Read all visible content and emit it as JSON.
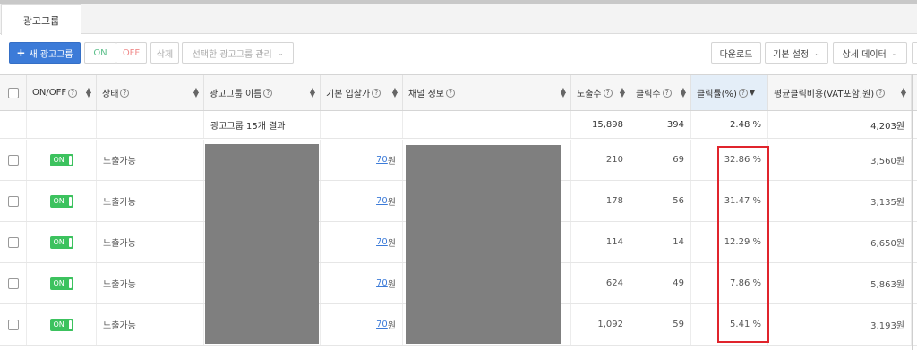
{
  "tab": {
    "label": "광고그룹"
  },
  "toolbar": {
    "new_label": "새 광고그룹",
    "new_icon": "plus-icon",
    "on_label": "ON",
    "off_label": "OFF",
    "delete_label": "삭제",
    "manage_label": "선택한 광고그룹 관리",
    "download_label": "다운로드",
    "basic_settings_label": "기본 설정",
    "detail_data_label": "상세 데이터"
  },
  "columns": {
    "onoff": "ON/OFF",
    "status": "상태",
    "name": "광고그룹 이름",
    "bid": "기본 입찰가",
    "channel": "채널 정보",
    "impressions": "노출수",
    "clicks": "클릭수",
    "ctr": "클릭률(%)",
    "cpc": "평균클릭비용(VAT포함,원)"
  },
  "summary": {
    "label": "광고그룹 15개 결과",
    "impressions": "15,898",
    "clicks": "394",
    "ctr": "2.48 %",
    "cpc": "4,203원"
  },
  "rows": [
    {
      "toggle": "ON",
      "status": "노출가능",
      "bid": "70",
      "bid_unit": "원",
      "impressions": "210",
      "clicks": "69",
      "ctr": "32.86 %",
      "cpc": "3,560원"
    },
    {
      "toggle": "ON",
      "status": "노출가능",
      "bid": "70",
      "bid_unit": "원",
      "impressions": "178",
      "clicks": "56",
      "ctr": "31.47 %",
      "cpc": "3,135원"
    },
    {
      "toggle": "ON",
      "status": "노출가능",
      "bid": "70",
      "bid_unit": "원",
      "impressions": "114",
      "clicks": "14",
      "ctr": "12.29 %",
      "cpc": "6,650원"
    },
    {
      "toggle": "ON",
      "status": "노출가능",
      "bid": "70",
      "bid_unit": "원",
      "impressions": "624",
      "clicks": "49",
      "ctr": "7.86 %",
      "cpc": "5,863원"
    },
    {
      "toggle": "ON",
      "status": "노출가능",
      "bid": "70",
      "bid_unit": "원",
      "impressions": "1,092",
      "clicks": "59",
      "ctr": "5.41 %",
      "cpc": "3,193원"
    }
  ],
  "colors": {
    "primary": "#3c7bd8",
    "toggle_on": "#3cc25e",
    "highlight_box": "#e0242c",
    "sorted_header": "#e4eef8",
    "redacted": "#7f7f7f"
  }
}
